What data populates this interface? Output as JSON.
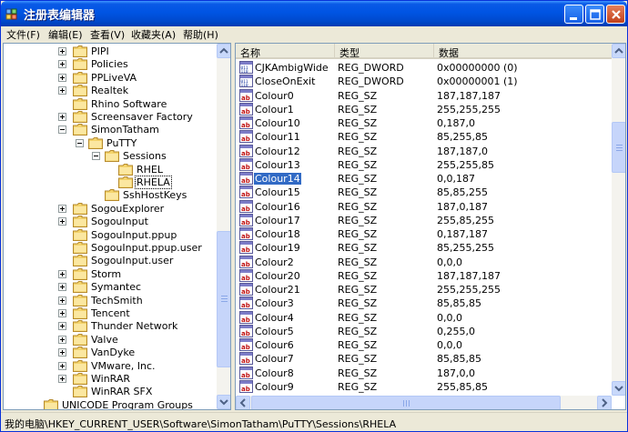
{
  "window": {
    "title": "注册表编辑器"
  },
  "menu": [
    "文件(F)",
    "编辑(E)",
    "查看(V)",
    "收藏夹(A)",
    "帮助(H)"
  ],
  "tree": [
    {
      "label": "PIPI",
      "level": 1,
      "expander": "plus"
    },
    {
      "label": "Policies",
      "level": 1,
      "expander": "plus"
    },
    {
      "label": "PPLiveVA",
      "level": 1,
      "expander": "plus"
    },
    {
      "label": "Realtek",
      "level": 1,
      "expander": "plus"
    },
    {
      "label": "Rhino Software",
      "level": 1,
      "expander": "none"
    },
    {
      "label": "Screensaver Factory",
      "level": 1,
      "expander": "plus"
    },
    {
      "label": "SimonTatham",
      "level": 1,
      "expander": "minus"
    },
    {
      "label": "PuTTY",
      "level": 2,
      "expander": "minus"
    },
    {
      "label": "Sessions",
      "level": 3,
      "expander": "minus"
    },
    {
      "label": "RHEL",
      "level": 4,
      "expander": "none"
    },
    {
      "label": "RHELA",
      "level": 4,
      "expander": "none",
      "selected": true
    },
    {
      "label": "SshHostKeys",
      "level": 3,
      "expander": "none"
    },
    {
      "label": "SogouExplorer",
      "level": 1,
      "expander": "plus"
    },
    {
      "label": "SogouInput",
      "level": 1,
      "expander": "plus"
    },
    {
      "label": "SogouInput.ppup",
      "level": 1,
      "expander": "none"
    },
    {
      "label": "SogouInput.ppup.user",
      "level": 1,
      "expander": "none"
    },
    {
      "label": "SogouInput.user",
      "level": 1,
      "expander": "none"
    },
    {
      "label": "Storm",
      "level": 1,
      "expander": "plus"
    },
    {
      "label": "Symantec",
      "level": 1,
      "expander": "plus"
    },
    {
      "label": "TechSmith",
      "level": 1,
      "expander": "plus"
    },
    {
      "label": "Tencent",
      "level": 1,
      "expander": "plus"
    },
    {
      "label": "Thunder Network",
      "level": 1,
      "expander": "plus"
    },
    {
      "label": "Valve",
      "level": 1,
      "expander": "plus"
    },
    {
      "label": "VanDyke",
      "level": 1,
      "expander": "plus"
    },
    {
      "label": "VMware, Inc.",
      "level": 1,
      "expander": "plus"
    },
    {
      "label": "WinRAR",
      "level": 1,
      "expander": "plus"
    },
    {
      "label": "WinRAR SFX",
      "level": 1,
      "expander": "none"
    },
    {
      "label": "UNICODE Program Groups",
      "level": 0,
      "expander": "none"
    }
  ],
  "list": {
    "columns": [
      "名称",
      "类型",
      "数据"
    ],
    "rows": [
      {
        "name": "CJKAmbigWide",
        "type": "REG_DWORD",
        "data": "0x00000000 (0)",
        "icon": "dword-icon"
      },
      {
        "name": "CloseOnExit",
        "type": "REG_DWORD",
        "data": "0x00000001 (1)",
        "icon": "dword-icon"
      },
      {
        "name": "Colour0",
        "type": "REG_SZ",
        "data": "187,187,187",
        "icon": "string-icon"
      },
      {
        "name": "Colour1",
        "type": "REG_SZ",
        "data": "255,255,255",
        "icon": "string-icon"
      },
      {
        "name": "Colour10",
        "type": "REG_SZ",
        "data": "0,187,0",
        "icon": "string-icon"
      },
      {
        "name": "Colour11",
        "type": "REG_SZ",
        "data": "85,255,85",
        "icon": "string-icon"
      },
      {
        "name": "Colour12",
        "type": "REG_SZ",
        "data": "187,187,0",
        "icon": "string-icon"
      },
      {
        "name": "Colour13",
        "type": "REG_SZ",
        "data": "255,255,85",
        "icon": "string-icon"
      },
      {
        "name": "Colour14",
        "type": "REG_SZ",
        "data": "0,0,187",
        "icon": "string-icon",
        "selected": true
      },
      {
        "name": "Colour15",
        "type": "REG_SZ",
        "data": "85,85,255",
        "icon": "string-icon"
      },
      {
        "name": "Colour16",
        "type": "REG_SZ",
        "data": "187,0,187",
        "icon": "string-icon"
      },
      {
        "name": "Colour17",
        "type": "REG_SZ",
        "data": "255,85,255",
        "icon": "string-icon"
      },
      {
        "name": "Colour18",
        "type": "REG_SZ",
        "data": "0,187,187",
        "icon": "string-icon"
      },
      {
        "name": "Colour19",
        "type": "REG_SZ",
        "data": "85,255,255",
        "icon": "string-icon"
      },
      {
        "name": "Colour2",
        "type": "REG_SZ",
        "data": "0,0,0",
        "icon": "string-icon"
      },
      {
        "name": "Colour20",
        "type": "REG_SZ",
        "data": "187,187,187",
        "icon": "string-icon"
      },
      {
        "name": "Colour21",
        "type": "REG_SZ",
        "data": "255,255,255",
        "icon": "string-icon"
      },
      {
        "name": "Colour3",
        "type": "REG_SZ",
        "data": "85,85,85",
        "icon": "string-icon"
      },
      {
        "name": "Colour4",
        "type": "REG_SZ",
        "data": "0,0,0",
        "icon": "string-icon"
      },
      {
        "name": "Colour5",
        "type": "REG_SZ",
        "data": "0,255,0",
        "icon": "string-icon"
      },
      {
        "name": "Colour6",
        "type": "REG_SZ",
        "data": "0,0,0",
        "icon": "string-icon"
      },
      {
        "name": "Colour7",
        "type": "REG_SZ",
        "data": "85,85,85",
        "icon": "string-icon"
      },
      {
        "name": "Colour8",
        "type": "REG_SZ",
        "data": "187,0,0",
        "icon": "string-icon"
      },
      {
        "name": "Colour9",
        "type": "REG_SZ",
        "data": "255,85,85",
        "icon": "string-icon"
      }
    ]
  },
  "statusbar": {
    "path": "我的电脑\\HKEY_CURRENT_USER\\Software\\SimonTatham\\PuTTY\\Sessions\\RHELA"
  },
  "colors": {
    "selection": "#316ac5",
    "titlebar": "#0054e3",
    "folder": "#f4d46c"
  }
}
